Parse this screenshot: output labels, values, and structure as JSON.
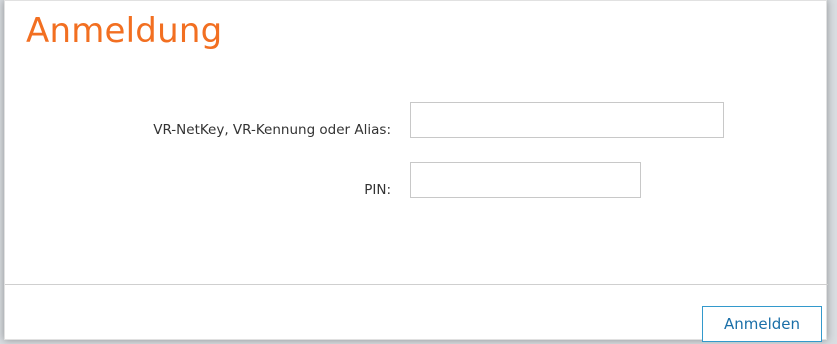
{
  "colors": {
    "title": "#f26f21",
    "button_text": "#1a6fa8",
    "button_border": "#3399cc"
  },
  "form": {
    "title": "Anmeldung",
    "username": {
      "label": "VR-NetKey, VR-Kennung oder Alias:",
      "value": "",
      "placeholder": ""
    },
    "pin": {
      "label": "PIN:",
      "value": "",
      "placeholder": ""
    },
    "submit_label": "Anmelden"
  }
}
